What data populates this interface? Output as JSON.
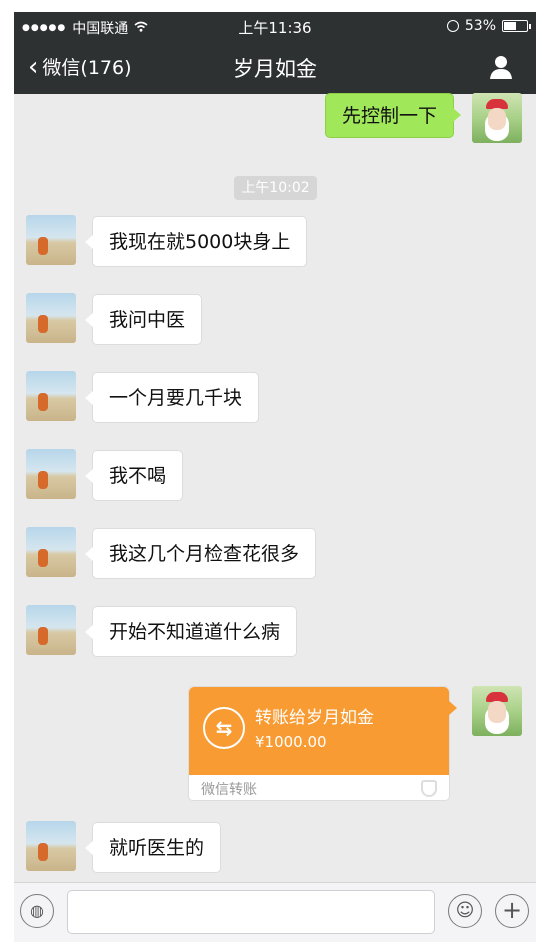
{
  "status_bar": {
    "carrier": "中国联通",
    "signal_dots": "●●●●●",
    "time": "上午11:36",
    "battery_percent": "53%",
    "battery_level": 0.53
  },
  "nav": {
    "back_label": "微信(176)",
    "title": "岁月如金"
  },
  "messages": {
    "sent_1": "先控制一下",
    "timestamp": "上午10:02",
    "received": [
      "我现在就5000块身上",
      "我问中医",
      "一个月要几千块",
      "我不喝",
      "我这几个月检查花很多",
      "开始不知道道什么病"
    ],
    "last_received": "就听医生的"
  },
  "transfer": {
    "title": "转账给岁月如金",
    "amount": "¥1000.00",
    "label": "微信转账",
    "icon": "⇆"
  },
  "input_bar": {
    "voice_icon": "◍",
    "emoji_icon": "☺",
    "plus_icon": "+"
  },
  "colors": {
    "nav_bg": "#2e3132",
    "chat_bg": "#ebebeb",
    "sent_bubble": "#a0e75a",
    "transfer": "#f89b32"
  }
}
